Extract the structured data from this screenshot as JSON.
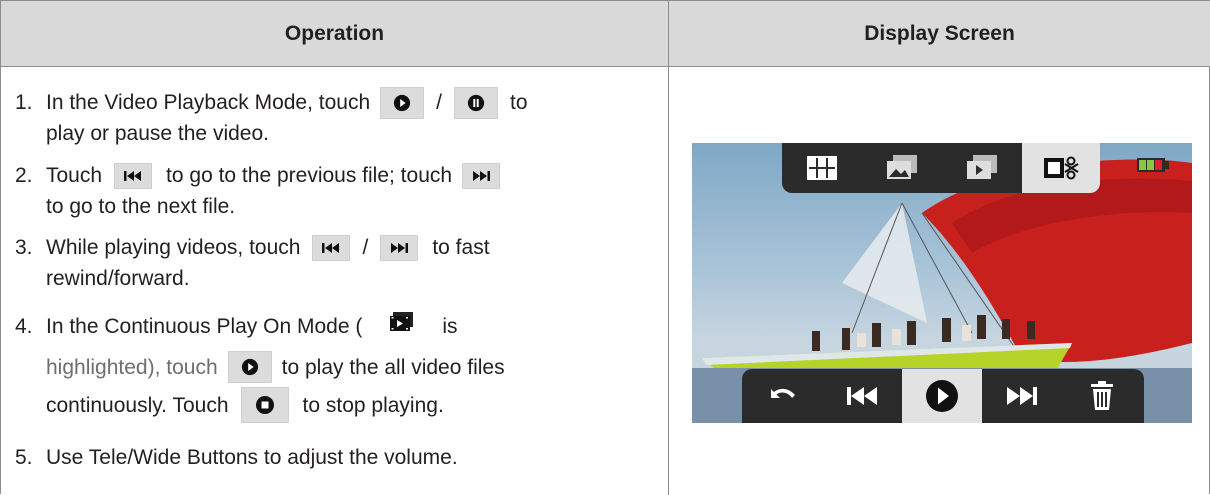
{
  "table": {
    "col_operation": "Operation",
    "col_display": "Display Screen"
  },
  "steps": [
    {
      "num": "1.",
      "part_a": "In the Video Playback Mode, touch",
      "sep": "/",
      "part_b": "to",
      "line2": "play or pause the video."
    },
    {
      "num": "2.",
      "part_a": "Touch",
      "part_b": "to go to the previous file; touch",
      "line2": "to go to the next file."
    },
    {
      "num": "3.",
      "part_a": "While playing videos, touch",
      "sep": "/",
      "part_b": "to fast",
      "line2": "rewind/forward."
    },
    {
      "num": "4.",
      "part_a": "In the Continuous Play On Mode (",
      "part_b": "is",
      "line2a": "highlighted), touch",
      "line2b": "to play the all video files",
      "line3a": "continuously. Touch",
      "line3b": "to stop playing."
    },
    {
      "num": "5.",
      "part_a": "Use Tele/Wide Buttons to adjust the volume."
    }
  ],
  "icons": {
    "play": "play-icon",
    "pause": "pause-icon",
    "prev": "previous-icon",
    "next": "next-icon",
    "continuous": "continuous-play-icon",
    "stop": "stop-icon",
    "thumbnails": "thumbnails-icon",
    "slideshow": "photo-slideshow-icon",
    "video_continuous": "video-continuous-icon",
    "edit": "video-edit-icon",
    "battery": "battery-icon",
    "back": "back-icon",
    "trash": "trash-icon"
  },
  "colors": {
    "header_bg": "#d9d9d9",
    "text": "#231f20",
    "bar_bg": "#2b2b2b",
    "selected_bg": "#e2e2e2",
    "sail_red": "#c8201c",
    "hull_green": "#b6d32a"
  }
}
